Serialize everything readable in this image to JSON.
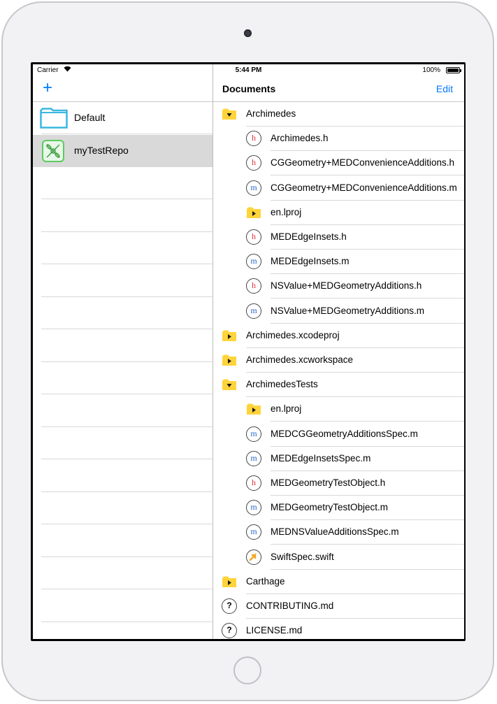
{
  "status_bar": {
    "carrier": "Carrier",
    "wifi": "wifi-icon",
    "time": "5:44 PM",
    "battery": "100%"
  },
  "left_pane": {
    "add_label": "+",
    "repos": [
      {
        "label": "Default",
        "icon": "folder-icon",
        "selected": false
      },
      {
        "label": "myTestRepo",
        "icon": "repo-icon",
        "selected": true
      }
    ]
  },
  "right_pane": {
    "title": "Documents",
    "edit_label": "Edit",
    "items": [
      {
        "name": "Archimedes",
        "type": "folder-open",
        "indent": 0
      },
      {
        "name": "Archimedes.h",
        "type": "h",
        "indent": 1
      },
      {
        "name": "CGGeometry+MEDConvenienceAdditions.h",
        "type": "h",
        "indent": 1
      },
      {
        "name": "CGGeometry+MEDConvenienceAdditions.m",
        "type": "m",
        "indent": 1
      },
      {
        "name": "en.lproj",
        "type": "folder-closed",
        "indent": 1
      },
      {
        "name": "MEDEdgeInsets.h",
        "type": "h",
        "indent": 1
      },
      {
        "name": "MEDEdgeInsets.m",
        "type": "m",
        "indent": 1
      },
      {
        "name": "NSValue+MEDGeometryAdditions.h",
        "type": "h",
        "indent": 1
      },
      {
        "name": "NSValue+MEDGeometryAdditions.m",
        "type": "m",
        "indent": 1
      },
      {
        "name": "Archimedes.xcodeproj",
        "type": "folder-closed",
        "indent": 0
      },
      {
        "name": "Archimedes.xcworkspace",
        "type": "folder-closed",
        "indent": 0
      },
      {
        "name": "ArchimedesTests",
        "type": "folder-open",
        "indent": 0
      },
      {
        "name": "en.lproj",
        "type": "folder-closed",
        "indent": 1
      },
      {
        "name": "MEDCGGeometryAdditionsSpec.m",
        "type": "m",
        "indent": 1
      },
      {
        "name": "MEDEdgeInsetsSpec.m",
        "type": "m",
        "indent": 1
      },
      {
        "name": "MEDGeometryTestObject.h",
        "type": "h",
        "indent": 1
      },
      {
        "name": "MEDGeometryTestObject.m",
        "type": "m",
        "indent": 1
      },
      {
        "name": "MEDNSValueAdditionsSpec.m",
        "type": "m",
        "indent": 1
      },
      {
        "name": "SwiftSpec.swift",
        "type": "swift",
        "indent": 1
      },
      {
        "name": "Carthage",
        "type": "folder-closed",
        "indent": 0
      },
      {
        "name": "CONTRIBUTING.md",
        "type": "unknown",
        "indent": 0
      },
      {
        "name": "LICENSE.md",
        "type": "unknown",
        "indent": 0
      }
    ]
  },
  "colors": {
    "accent": "#007aff",
    "folder": "#ffd43b",
    "header_file": "#e0343a",
    "impl_file": "#2a6ac9",
    "repo_green": "#5ccb5f",
    "folder_blue": "#3ab7e0"
  }
}
